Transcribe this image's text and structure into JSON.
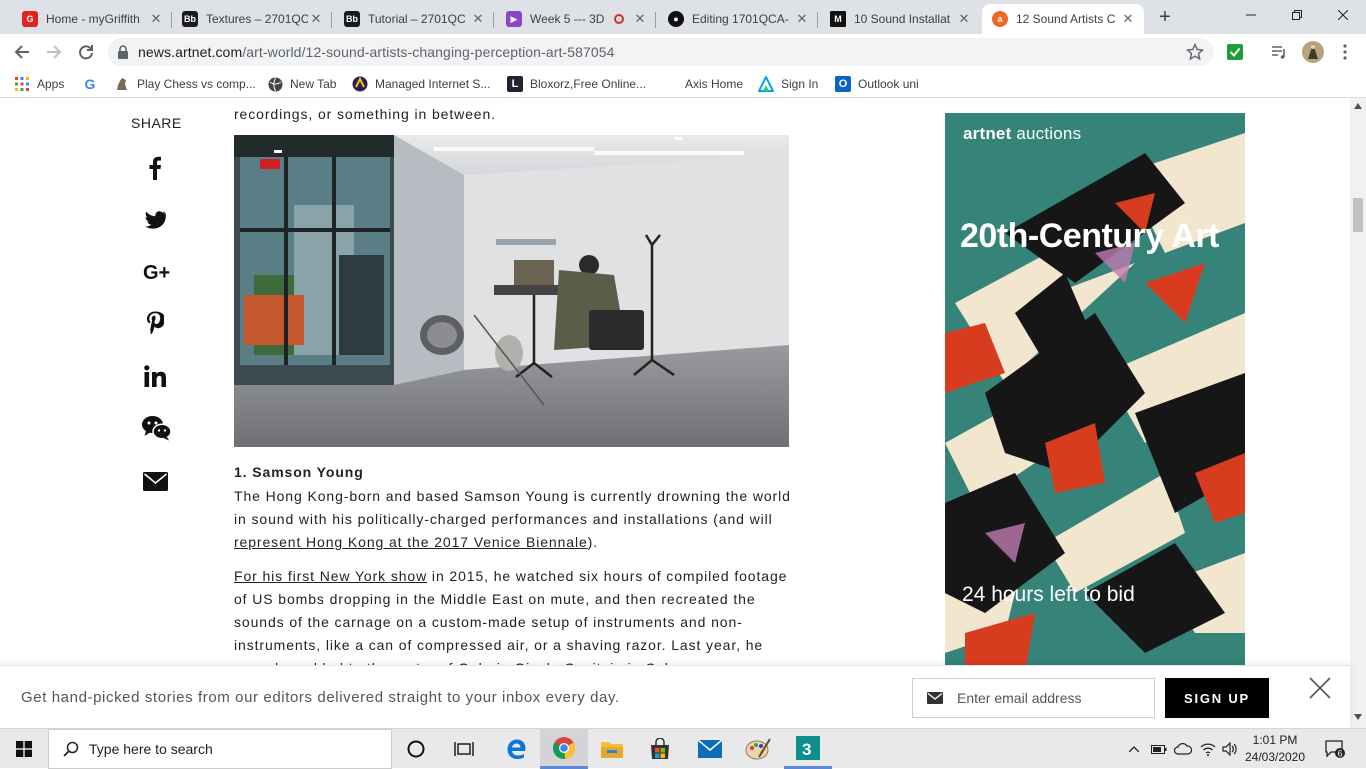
{
  "browser": {
    "tabs": [
      {
        "title": "Home - myGriffith",
        "favicon_color": "#e02323",
        "favicon_text": "G"
      },
      {
        "title": "Textures – 2701QC",
        "favicon_color": "#1a1a1a",
        "favicon_text": "Bb"
      },
      {
        "title": "Tutorial – 2701QC",
        "favicon_color": "#1a1a1a",
        "favicon_text": "Bb"
      },
      {
        "title": "Week 5 --- 3D",
        "favicon_color": "#8e44c7",
        "favicon_text": "▶"
      },
      {
        "title": "Editing 1701QCA-",
        "favicon_color": "#111111",
        "favicon_text": "●"
      },
      {
        "title": "10 Sound Installat",
        "favicon_color": "#111111",
        "favicon_text": "M"
      },
      {
        "title": "12 Sound Artists C",
        "favicon_color": "#f26522",
        "favicon_text": "a"
      }
    ],
    "active_tab": 6,
    "url_domain": "news.artnet.com",
    "url_path": "/art-world/12-sound-artists-changing-perception-art-587054",
    "bookmarks": [
      {
        "label": "Apps",
        "icon": "apps-grid-icon"
      },
      {
        "label": "",
        "icon": "google-icon"
      },
      {
        "label": "Play Chess vs comp...",
        "icon": "chess-icon"
      },
      {
        "label": "New Tab",
        "icon": "globe-icon"
      },
      {
        "label": "Managed Internet S...",
        "icon": "managed-icon"
      },
      {
        "label": "Bloxorz,Free Online...",
        "icon": "bloxorz-icon"
      },
      {
        "label": "Axis Home",
        "icon": "axis-icon"
      },
      {
        "label": "Sign In",
        "icon": "sign-in-icon"
      },
      {
        "label": "Outlook uni",
        "icon": "outlook-icon"
      }
    ]
  },
  "page": {
    "share_label": "SHARE",
    "share_icons": [
      "facebook-icon",
      "twitter-icon",
      "google-plus-icon",
      "pinterest-icon",
      "linkedin-icon",
      "wechat-icon",
      "email-icon"
    ],
    "lead_line": "recordings, or something in between.",
    "section_heading": "1. Samson Young",
    "para1_before": "The Hong Kong-born and based Samson Young is currently drowning the world in sound with his politically-charged performances and installations (and will ",
    "para1_link": "represent Hong Kong at the 2017 Venice Biennale",
    "para1_after": ").",
    "para2_link": "For his first New York show",
    "para2_after": " in 2015, he watched six hours of compiled footage of US bombs dropping in the Middle East on mute, and then recreated the sounds of the carnage on a custom-made setup of instruments and non-instruments, like a can of compressed air, or a shaving razor. Last year, he was also added to the roster of Galerie Gisela Capitain in Cologne.",
    "ad": {
      "brand_bold": "artnet",
      "brand_rest": " auctions",
      "title": "20th-Century Art",
      "cta": "24 hours left to bid"
    }
  },
  "newsletter": {
    "text": "Get hand-picked stories from our editors delivered straight to your inbox every day.",
    "email_placeholder": "Enter email address",
    "button": "SIGN UP"
  },
  "taskbar": {
    "search_placeholder": "Type here to search",
    "time": "1:01 PM",
    "date": "24/03/2020",
    "notification_count": "6"
  }
}
